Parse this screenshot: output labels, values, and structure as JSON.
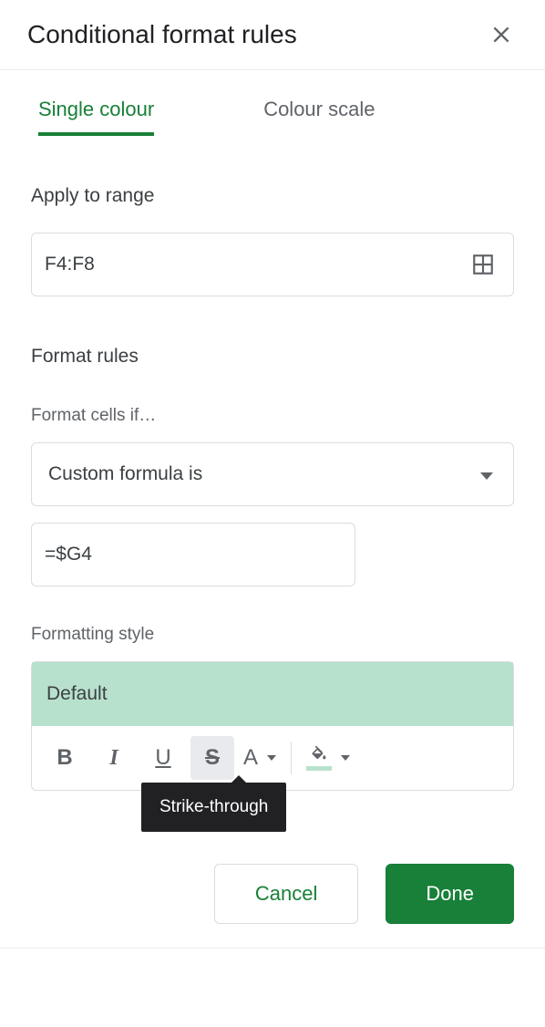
{
  "header": {
    "title": "Conditional format rules"
  },
  "tabs": {
    "single": "Single colour",
    "scale": "Colour scale",
    "active": "single"
  },
  "range": {
    "label": "Apply to range",
    "value": "F4:F8"
  },
  "rules": {
    "label": "Format rules",
    "conditionLabel": "Format cells if…",
    "conditionSelected": "Custom formula is",
    "formulaValue": "=$G4"
  },
  "style": {
    "label": "Formatting style",
    "preview": "Default",
    "tooltip": "Strike-through"
  },
  "actions": {
    "cancel": "Cancel",
    "done": "Done"
  }
}
